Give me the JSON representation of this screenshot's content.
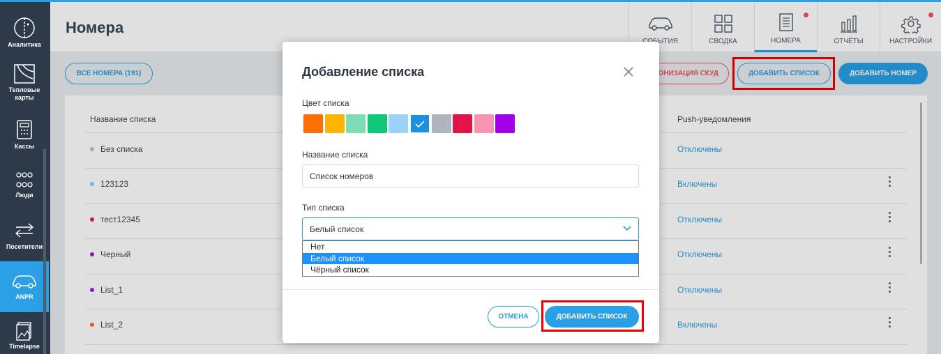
{
  "sidebar": {
    "items": [
      {
        "label": "Аналитика",
        "icon": "analytics-icon"
      },
      {
        "label": "Тепловые карты",
        "icon": "heatmap-icon"
      },
      {
        "label": "Кассы",
        "icon": "cash-register-icon"
      },
      {
        "label": "Люди",
        "icon": "people-icon"
      },
      {
        "label": "Посетители",
        "icon": "visitors-icon"
      },
      {
        "label": "ANPR",
        "icon": "car-icon",
        "active": true
      },
      {
        "label": "Timelapse",
        "icon": "timelapse-icon"
      }
    ]
  },
  "header": {
    "title": "Номера",
    "tabs": [
      {
        "label": "СОБЫТИЯ",
        "icon": "car-icon"
      },
      {
        "label": "СВОДКА",
        "icon": "grid-icon"
      },
      {
        "label": "НОМЕРА",
        "icon": "document-icon",
        "active": true,
        "badge": true
      },
      {
        "label": "ОТЧЁТЫ",
        "icon": "bar-chart-icon"
      },
      {
        "label": "НАСТРОЙКИ",
        "icon": "gear-icon",
        "badge": true
      }
    ]
  },
  "toolbar": {
    "all_numbers": "ВСЕ НОМЕРА (191)",
    "sync_skud": "ОНИЗАЦИЯ СКУД",
    "add_list": "ДОБАВИТЬ СПИСОК",
    "add_number": "ДОБАВИТЬ НОМЕР"
  },
  "table": {
    "columns": {
      "name": "Название списка",
      "push": "Push-уведомления"
    },
    "rows": [
      {
        "name": "Без списка",
        "color": "#b8bcc6",
        "push": "Отключены",
        "menu": false
      },
      {
        "name": "123123",
        "color": "#8ecbf0",
        "push": "Включены",
        "menu": true
      },
      {
        "name": "тест12345",
        "color": "#e0204f",
        "push": "Отключены",
        "menu": true
      },
      {
        "name": "Черный",
        "color": "#9b1bd6",
        "push": "Отключены",
        "menu": true
      },
      {
        "name": "List_1",
        "color": "#9b1bd6",
        "push": "Отключены",
        "menu": true
      },
      {
        "name": "List_2",
        "color": "#f7711d",
        "push": "Включены",
        "menu": true
      }
    ]
  },
  "modal": {
    "title": "Добавление списка",
    "color_label": "Цвет списка",
    "colors": [
      "#ff6e00",
      "#ffb400",
      "#7fdcb3",
      "#10c87a",
      "#99d3f7",
      "#1a8fe3",
      "#aeb5be",
      "#e3134a",
      "#f595b2",
      "#a100e8"
    ],
    "selected_color_index": 5,
    "name_label": "Название списка",
    "name_value": "Список номеров",
    "type_label": "Тип списка",
    "type_value": "Белый список",
    "type_options": [
      "Нет",
      "Белый список",
      "Чёрный список"
    ],
    "type_highlight_index": 1,
    "cancel": "ОТМЕНА",
    "submit": "ДОБАВИТЬ СПИСОК"
  }
}
